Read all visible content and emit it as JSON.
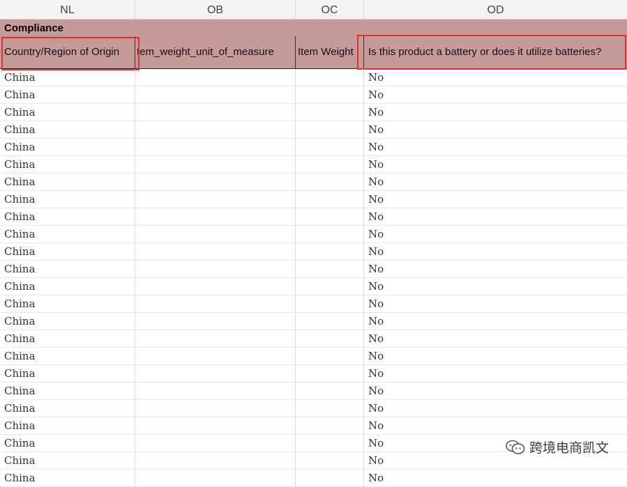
{
  "columns": [
    "NL",
    "OB",
    "OC",
    "OD"
  ],
  "group_label": "Compliance",
  "fields": [
    "Country/Region of Origin",
    "tem_weight_unit_of_measure",
    "Item Weight",
    "Is this product a battery or does it utilize batteries?"
  ],
  "rows": [
    {
      "origin": "China",
      "battery": "No"
    },
    {
      "origin": "China",
      "battery": "No"
    },
    {
      "origin": "China",
      "battery": "No"
    },
    {
      "origin": "China",
      "battery": "No"
    },
    {
      "origin": "China",
      "battery": "No"
    },
    {
      "origin": "China",
      "battery": "No"
    },
    {
      "origin": "China",
      "battery": "No"
    },
    {
      "origin": "China",
      "battery": "No"
    },
    {
      "origin": "China",
      "battery": "No"
    },
    {
      "origin": "China",
      "battery": "No"
    },
    {
      "origin": "China",
      "battery": "No"
    },
    {
      "origin": "China",
      "battery": "No"
    },
    {
      "origin": "China",
      "battery": "No"
    },
    {
      "origin": "China",
      "battery": "No"
    },
    {
      "origin": "China",
      "battery": "No"
    },
    {
      "origin": "China",
      "battery": "No"
    },
    {
      "origin": "China",
      "battery": "No"
    },
    {
      "origin": "China",
      "battery": "No"
    },
    {
      "origin": "China",
      "battery": "No"
    },
    {
      "origin": "China",
      "battery": "No"
    },
    {
      "origin": "China",
      "battery": "No"
    },
    {
      "origin": "China",
      "battery": "No"
    },
    {
      "origin": "China",
      "battery": "No"
    },
    {
      "origin": "China",
      "battery": "No"
    }
  ],
  "watermark": "跨境电商凯文",
  "colors": {
    "header_band": "#c79a9a",
    "highlight": "#e03131"
  }
}
